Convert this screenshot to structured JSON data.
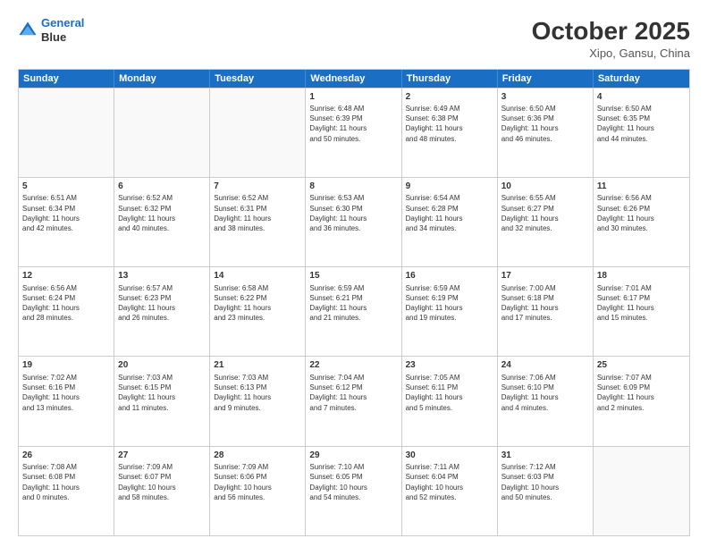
{
  "header": {
    "logo_line1": "General",
    "logo_line2": "Blue",
    "month": "October 2025",
    "location": "Xipo, Gansu, China"
  },
  "days_of_week": [
    "Sunday",
    "Monday",
    "Tuesday",
    "Wednesday",
    "Thursday",
    "Friday",
    "Saturday"
  ],
  "weeks": [
    [
      {
        "day": "",
        "info": ""
      },
      {
        "day": "",
        "info": ""
      },
      {
        "day": "",
        "info": ""
      },
      {
        "day": "1",
        "info": "Sunrise: 6:48 AM\nSunset: 6:39 PM\nDaylight: 11 hours\nand 50 minutes."
      },
      {
        "day": "2",
        "info": "Sunrise: 6:49 AM\nSunset: 6:38 PM\nDaylight: 11 hours\nand 48 minutes."
      },
      {
        "day": "3",
        "info": "Sunrise: 6:50 AM\nSunset: 6:36 PM\nDaylight: 11 hours\nand 46 minutes."
      },
      {
        "day": "4",
        "info": "Sunrise: 6:50 AM\nSunset: 6:35 PM\nDaylight: 11 hours\nand 44 minutes."
      }
    ],
    [
      {
        "day": "5",
        "info": "Sunrise: 6:51 AM\nSunset: 6:34 PM\nDaylight: 11 hours\nand 42 minutes."
      },
      {
        "day": "6",
        "info": "Sunrise: 6:52 AM\nSunset: 6:32 PM\nDaylight: 11 hours\nand 40 minutes."
      },
      {
        "day": "7",
        "info": "Sunrise: 6:52 AM\nSunset: 6:31 PM\nDaylight: 11 hours\nand 38 minutes."
      },
      {
        "day": "8",
        "info": "Sunrise: 6:53 AM\nSunset: 6:30 PM\nDaylight: 11 hours\nand 36 minutes."
      },
      {
        "day": "9",
        "info": "Sunrise: 6:54 AM\nSunset: 6:28 PM\nDaylight: 11 hours\nand 34 minutes."
      },
      {
        "day": "10",
        "info": "Sunrise: 6:55 AM\nSunset: 6:27 PM\nDaylight: 11 hours\nand 32 minutes."
      },
      {
        "day": "11",
        "info": "Sunrise: 6:56 AM\nSunset: 6:26 PM\nDaylight: 11 hours\nand 30 minutes."
      }
    ],
    [
      {
        "day": "12",
        "info": "Sunrise: 6:56 AM\nSunset: 6:24 PM\nDaylight: 11 hours\nand 28 minutes."
      },
      {
        "day": "13",
        "info": "Sunrise: 6:57 AM\nSunset: 6:23 PM\nDaylight: 11 hours\nand 26 minutes."
      },
      {
        "day": "14",
        "info": "Sunrise: 6:58 AM\nSunset: 6:22 PM\nDaylight: 11 hours\nand 23 minutes."
      },
      {
        "day": "15",
        "info": "Sunrise: 6:59 AM\nSunset: 6:21 PM\nDaylight: 11 hours\nand 21 minutes."
      },
      {
        "day": "16",
        "info": "Sunrise: 6:59 AM\nSunset: 6:19 PM\nDaylight: 11 hours\nand 19 minutes."
      },
      {
        "day": "17",
        "info": "Sunrise: 7:00 AM\nSunset: 6:18 PM\nDaylight: 11 hours\nand 17 minutes."
      },
      {
        "day": "18",
        "info": "Sunrise: 7:01 AM\nSunset: 6:17 PM\nDaylight: 11 hours\nand 15 minutes."
      }
    ],
    [
      {
        "day": "19",
        "info": "Sunrise: 7:02 AM\nSunset: 6:16 PM\nDaylight: 11 hours\nand 13 minutes."
      },
      {
        "day": "20",
        "info": "Sunrise: 7:03 AM\nSunset: 6:15 PM\nDaylight: 11 hours\nand 11 minutes."
      },
      {
        "day": "21",
        "info": "Sunrise: 7:03 AM\nSunset: 6:13 PM\nDaylight: 11 hours\nand 9 minutes."
      },
      {
        "day": "22",
        "info": "Sunrise: 7:04 AM\nSunset: 6:12 PM\nDaylight: 11 hours\nand 7 minutes."
      },
      {
        "day": "23",
        "info": "Sunrise: 7:05 AM\nSunset: 6:11 PM\nDaylight: 11 hours\nand 5 minutes."
      },
      {
        "day": "24",
        "info": "Sunrise: 7:06 AM\nSunset: 6:10 PM\nDaylight: 11 hours\nand 4 minutes."
      },
      {
        "day": "25",
        "info": "Sunrise: 7:07 AM\nSunset: 6:09 PM\nDaylight: 11 hours\nand 2 minutes."
      }
    ],
    [
      {
        "day": "26",
        "info": "Sunrise: 7:08 AM\nSunset: 6:08 PM\nDaylight: 11 hours\nand 0 minutes."
      },
      {
        "day": "27",
        "info": "Sunrise: 7:09 AM\nSunset: 6:07 PM\nDaylight: 10 hours\nand 58 minutes."
      },
      {
        "day": "28",
        "info": "Sunrise: 7:09 AM\nSunset: 6:06 PM\nDaylight: 10 hours\nand 56 minutes."
      },
      {
        "day": "29",
        "info": "Sunrise: 7:10 AM\nSunset: 6:05 PM\nDaylight: 10 hours\nand 54 minutes."
      },
      {
        "day": "30",
        "info": "Sunrise: 7:11 AM\nSunset: 6:04 PM\nDaylight: 10 hours\nand 52 minutes."
      },
      {
        "day": "31",
        "info": "Sunrise: 7:12 AM\nSunset: 6:03 PM\nDaylight: 10 hours\nand 50 minutes."
      },
      {
        "day": "",
        "info": ""
      }
    ]
  ]
}
